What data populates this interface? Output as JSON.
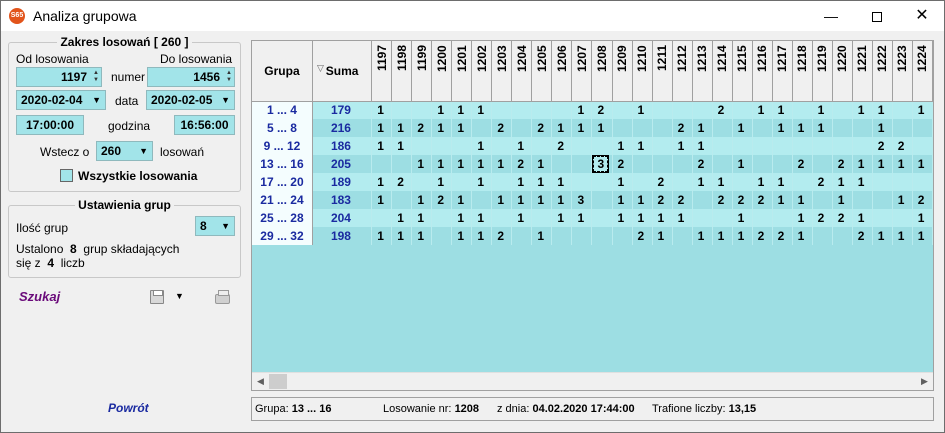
{
  "window": {
    "title": "Analiza grupowa",
    "app_icon_text": "S65",
    "minimize": "—",
    "close": "✕"
  },
  "range": {
    "title": "Zakres losowań  [ 260 ]",
    "from_label": "Od losowania",
    "to_label": "Do losowania",
    "from_number": "1197",
    "to_number": "1456",
    "number_label": "numer",
    "from_date": "2020-02-04",
    "to_date": "2020-02-05",
    "date_label": "data",
    "from_time": "17:00:00",
    "to_time": "16:56:00",
    "time_label": "godzina",
    "back_label": "Wstecz o",
    "back_value": "260",
    "back_unit": "losowań",
    "all_draws_label": "Wszystkie losowania",
    "all_draws_checked": false
  },
  "groups": {
    "title": "Ustawienia grup",
    "count_label": "Ilość grup",
    "count_value": "8",
    "summary_prefix": "Ustalono",
    "summary_count": "8",
    "summary_mid": "grup składających",
    "summary_line2_prefix": "się z",
    "summary_numbers": "4",
    "summary_suffix": "liczb"
  },
  "actions": {
    "search": "Szukaj",
    "back": "Powrót",
    "save_icon": "save-icon",
    "print_icon": "printer-icon"
  },
  "grid": {
    "col_group": "Grupa",
    "col_sum": "Suma",
    "draws": [
      "1197",
      "1198",
      "1199",
      "1200",
      "1201",
      "1202",
      "1203",
      "1204",
      "1205",
      "1206",
      "1207",
      "1208",
      "1209",
      "1210",
      "1211",
      "1212",
      "1213",
      "1214",
      "1215",
      "1216",
      "1217",
      "1218",
      "1219",
      "1220",
      "1221",
      "1222",
      "1223",
      "1224"
    ],
    "rows": [
      {
        "group": "1 ... 4",
        "sum": "179",
        "cells": [
          "1",
          "",
          "",
          "1",
          "1",
          "1",
          "",
          "",
          "",
          "",
          "1",
          "2",
          "",
          "1",
          "",
          "",
          "",
          "2",
          "",
          "1",
          "1",
          "",
          "1",
          "",
          "1",
          "1",
          "",
          "1"
        ]
      },
      {
        "group": "5 ... 8",
        "sum": "216",
        "cells": [
          "1",
          "1",
          "2",
          "1",
          "1",
          "",
          "2",
          "",
          "2",
          "1",
          "1",
          "1",
          "",
          "",
          "",
          "2",
          "1",
          "",
          "1",
          "",
          "1",
          "1",
          "1",
          "",
          "",
          "1",
          "",
          ""
        ]
      },
      {
        "group": "9 ... 12",
        "sum": "186",
        "cells": [
          "1",
          "1",
          "",
          "",
          "",
          "1",
          "",
          "1",
          "",
          "2",
          "",
          "",
          "1",
          "1",
          "",
          "1",
          "1",
          "",
          "",
          "",
          "",
          "",
          "",
          "",
          "",
          "2",
          "2",
          ""
        ]
      },
      {
        "group": "13 ... 16",
        "sum": "205",
        "cells": [
          "",
          "",
          "1",
          "1",
          "1",
          "1",
          "1",
          "2",
          "1",
          "",
          "",
          "3",
          "2",
          "",
          "",
          "",
          "2",
          "",
          "1",
          "",
          "",
          "2",
          "",
          "2",
          "1",
          "1",
          "1",
          "1"
        ]
      },
      {
        "group": "17 ... 20",
        "sum": "189",
        "cells": [
          "1",
          "2",
          "",
          "1",
          "",
          "1",
          "",
          "1",
          "1",
          "1",
          "",
          "",
          "1",
          "",
          "2",
          "",
          "1",
          "1",
          "",
          "1",
          "1",
          "",
          "2",
          "1",
          "1",
          "",
          "",
          ""
        ]
      },
      {
        "group": "21 ... 24",
        "sum": "183",
        "cells": [
          "1",
          "",
          "1",
          "2",
          "1",
          "",
          "1",
          "1",
          "1",
          "1",
          "3",
          "",
          "1",
          "1",
          "2",
          "2",
          "",
          "2",
          "2",
          "2",
          "1",
          "1",
          "",
          "1",
          "",
          "",
          "1",
          "2"
        ]
      },
      {
        "group": "25 ... 28",
        "sum": "204",
        "cells": [
          "",
          "1",
          "1",
          "",
          "1",
          "1",
          "",
          "1",
          "",
          "1",
          "1",
          "",
          "1",
          "1",
          "1",
          "1",
          "",
          "",
          "1",
          "",
          "",
          "1",
          "2",
          "2",
          "1",
          "",
          "",
          "1"
        ]
      },
      {
        "group": "29 ... 32",
        "sum": "198",
        "cells": [
          "1",
          "1",
          "1",
          "",
          "1",
          "1",
          "2",
          "",
          "1",
          "",
          "",
          "",
          "",
          "2",
          "1",
          "",
          "1",
          "1",
          "1",
          "2",
          "2",
          "1",
          "",
          "",
          "2",
          "1",
          "1",
          "1"
        ]
      }
    ],
    "selected": {
      "row": 3,
      "col": 11
    },
    "scroll_left": "◀",
    "scroll_right": "▶"
  },
  "status": {
    "group_label": "Grupa:",
    "group_value": "13 ... 16",
    "draw_label": "Losowanie nr:",
    "draw_value": "1208",
    "date_label": "z dnia:",
    "date_value": "04.02.2020 17:44:00",
    "hits_label": "Trafione liczby:",
    "hits_value": "13,15"
  },
  "colors": {
    "field_bg": "#a2e4e9",
    "row_light": "#b3ecef",
    "row_dark": "#9ddee3",
    "number_blue": "#1a2aa0",
    "link_purple": "#6a0a7a"
  }
}
